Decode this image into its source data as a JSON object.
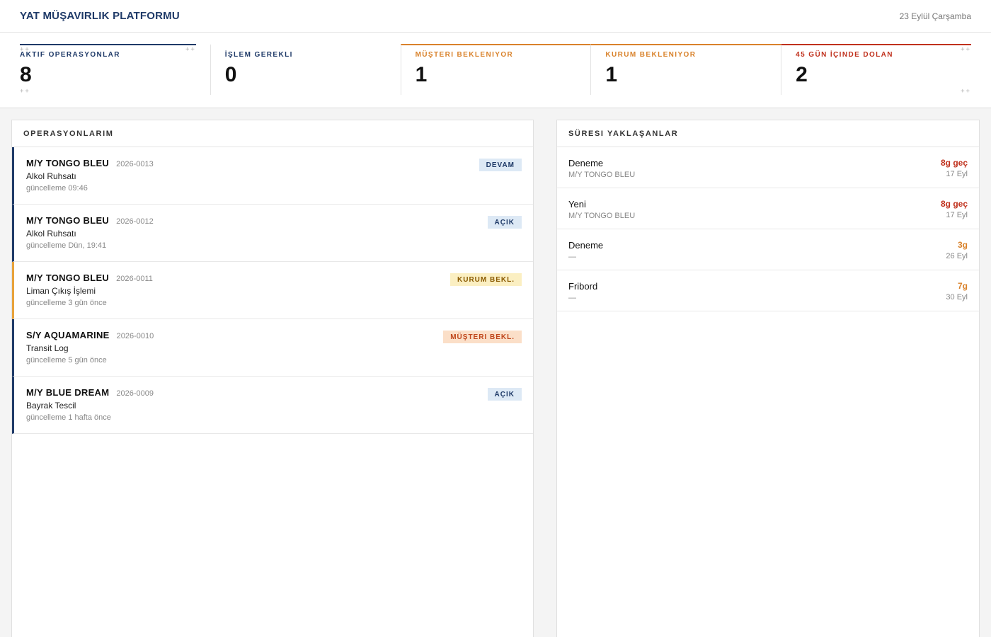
{
  "header": {
    "title": "YAT MÜŞAVIRLIK PLATFORMU",
    "date": "23 Eylül Çarşamba"
  },
  "stats": [
    {
      "label": "AKTIF OPERASYONLAR",
      "value": "8"
    },
    {
      "label": "İŞLEM GEREKLI",
      "value": "0"
    },
    {
      "label": "MÜŞTERI BEKLENIYOR",
      "value": "1"
    },
    {
      "label": "KURUM BEKLENIYOR",
      "value": "1"
    },
    {
      "label": "45 GÜN İÇINDE DOLAN",
      "value": "2"
    }
  ],
  "operations": {
    "title": "OPERASYONLARIM",
    "items": [
      {
        "vessel": "M/Y TONGO BLEU",
        "code": "2026-0013",
        "type": "Alkol Ruhsatı",
        "updated": "güncelleme 09:46",
        "status": "DEVAM"
      },
      {
        "vessel": "M/Y TONGO BLEU",
        "code": "2026-0012",
        "type": "Alkol Ruhsatı",
        "updated": "güncelleme Dün, 19:41",
        "status": "AÇIK"
      },
      {
        "vessel": "M/Y TONGO BLEU",
        "code": "2026-0011",
        "type": "Liman Çıkış İşlemi",
        "updated": "güncelleme 3 gün önce",
        "status": "KURUM BEKL."
      },
      {
        "vessel": "S/Y AQUAMARINE",
        "code": "2026-0010",
        "type": "Transit Log",
        "updated": "güncelleme 5 gün önce",
        "status": "MÜŞTERI BEKL."
      },
      {
        "vessel": "M/Y BLUE DREAM",
        "code": "2026-0009",
        "type": "Bayrak Tescil",
        "updated": "güncelleme 1 hafta önce",
        "status": "AÇIK"
      }
    ]
  },
  "deadlines": {
    "title": "SÜRESI YAKLAŞANLAR",
    "items": [
      {
        "title": "Deneme",
        "vessel": "M/Y TONGO BLEU",
        "remaining": "8g geç",
        "date": "17 Eyl"
      },
      {
        "title": "Yeni",
        "vessel": "M/Y TONGO BLEU",
        "remaining": "8g geç",
        "date": "17 Eyl"
      },
      {
        "title": "Deneme",
        "vessel": "—",
        "remaining": "3g",
        "date": "26 Eyl"
      },
      {
        "title": "Fribord",
        "vessel": "—",
        "remaining": "7g",
        "date": "30 Eyl"
      }
    ]
  },
  "colors": {
    "navy": "#1f3a68",
    "orange": "#d9822b",
    "red": "#c0311d"
  }
}
